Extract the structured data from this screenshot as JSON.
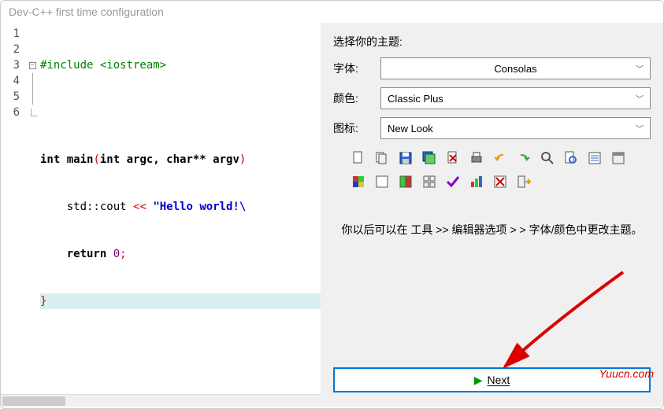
{
  "window": {
    "title": "Dev-C++ first time configuration"
  },
  "editor": {
    "lines": [
      "1",
      "2",
      "3",
      "4",
      "5",
      "6"
    ],
    "include": "#include <iostream>",
    "main_kw": "int main",
    "main_args_open": "(",
    "main_args": "int argc, char** argv",
    "main_args_close": ")",
    "cout": "    std::cout ",
    "lshift": "<< ",
    "hello": "\"Hello world!\\",
    "return_kw": "    return ",
    "zero": "0",
    "semi": ";",
    "close_brace": "}"
  },
  "panel": {
    "group_label": "选择你的主题:",
    "font_label": "字体:",
    "font_value": "Consolas",
    "color_label": "颜色:",
    "color_value": "Classic Plus",
    "icon_label": "图标:",
    "icon_value": "New Look",
    "hint": "你以后可以在 工具 >> 编辑器选项 > > 字体/颜色中更改主题。",
    "next_label": "Next"
  },
  "watermark": "Yuucn.com",
  "icons": [
    "new-file",
    "new-many",
    "save",
    "save-all",
    "close-file",
    "print",
    "undo",
    "redo",
    "search",
    "search-doc",
    "list",
    "props",
    "grid-colors",
    "window",
    "colors-2",
    "grid-4",
    "check",
    "chart",
    "delete",
    "exit"
  ]
}
